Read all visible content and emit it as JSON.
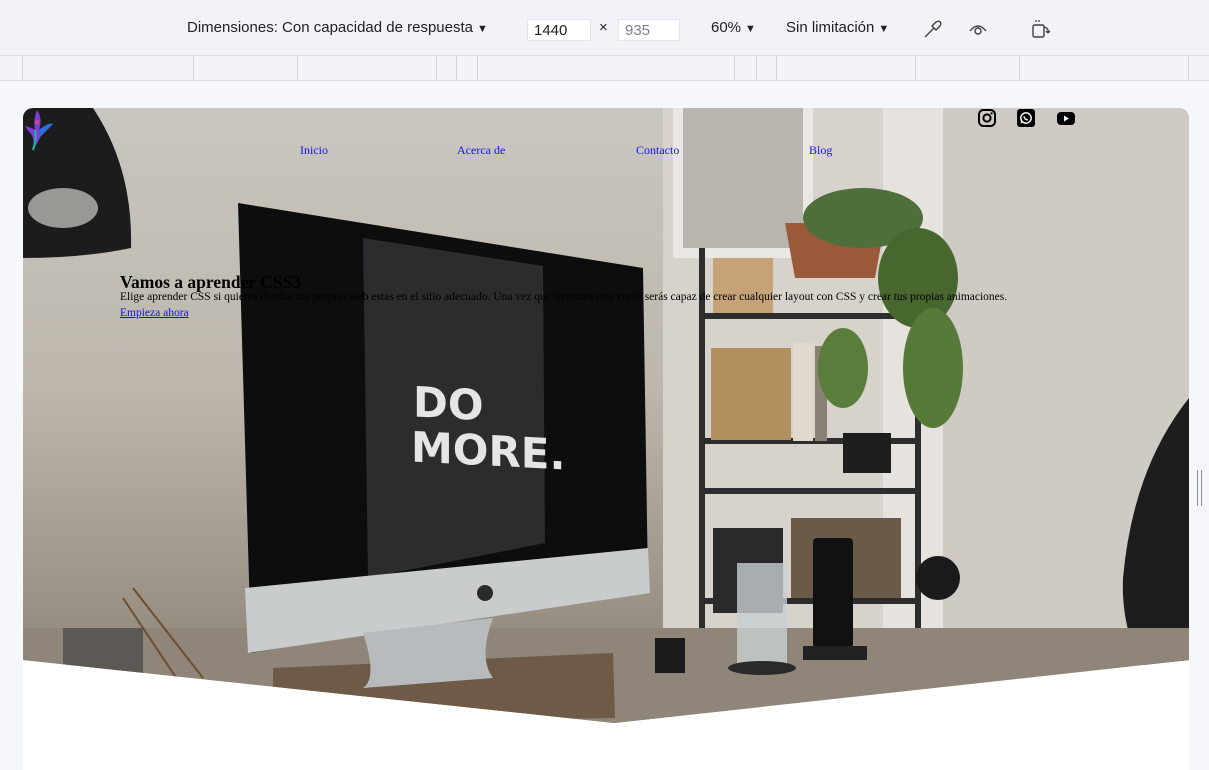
{
  "toolbar": {
    "dimensions_label": "Dimensiones: Con capacidad de respuesta",
    "width": "1440",
    "height": "935",
    "times": "×",
    "zoom": "60%",
    "throttle": "Sin limitación",
    "icons": [
      "chevron-down-icon",
      "eyedropper-icon",
      "eye-icon",
      "rotate-device-icon"
    ]
  },
  "site": {
    "nav": [
      "Inicio",
      "Acerca de",
      "Contacto",
      "Blog"
    ],
    "social_icons": [
      "instagram-icon",
      "whatsapp-icon",
      "youtube-icon"
    ],
    "hero": {
      "title": "Vamos a aprender CSS3",
      "text": "Elige aprender CSS si quieres diseñar tus propias web estas en el sitio adecuado. Una vez que termines este curso serás capaz de crear cualquier layout con CSS y crear tus propias animaciones.",
      "cta": "Empieza ahora",
      "monitor_text_1": "DO",
      "monitor_text_2": "MORE."
    }
  },
  "colors": {
    "link": "#1414ee",
    "toolbar_bg": "#f1f3f9"
  }
}
